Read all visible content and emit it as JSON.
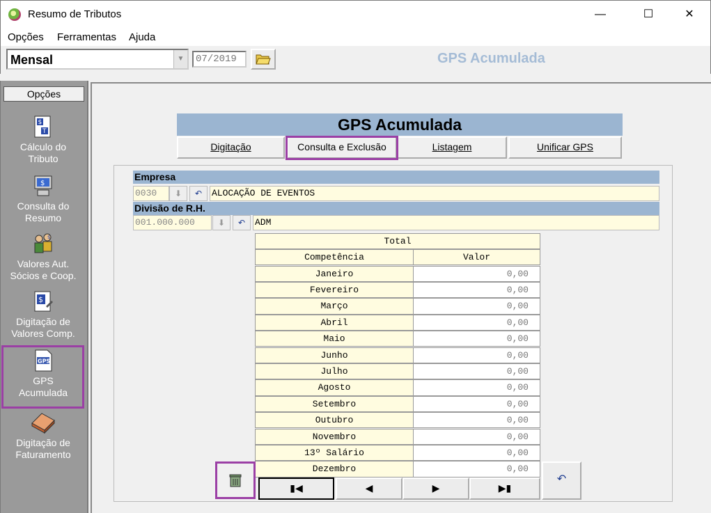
{
  "window": {
    "title": "Resumo de Tributos"
  },
  "menu": {
    "items": [
      "Opções",
      "Ferramentas",
      "Ajuda"
    ]
  },
  "toolbar": {
    "mode": "Mensal",
    "period": "07/2019",
    "header_title": "GPS Acumulada"
  },
  "sidebar": {
    "header": "Opções",
    "items": [
      {
        "label1": "Cálculo do",
        "label2": "Tributo"
      },
      {
        "label1": "Consulta do",
        "label2": "Resumo"
      },
      {
        "label1": "Valores Aut.",
        "label2": "Sócios e  Coop."
      },
      {
        "label1": "Digitação de",
        "label2": "Valores Comp."
      },
      {
        "label1": "GPS",
        "label2": "Acumulada"
      },
      {
        "label1": "Digitação de",
        "label2": "Faturamento"
      }
    ]
  },
  "main": {
    "title": "GPS Acumulada",
    "tabs": [
      "Digitação",
      "Consulta e Exclusão",
      "Listagem",
      "Unificar GPS"
    ],
    "empresa": {
      "label": "Empresa",
      "code": "0030",
      "name": "ALOCAÇÃO DE EVENTOS"
    },
    "divisao": {
      "label": "Divisão de R.H.",
      "code": "001.000.000",
      "name": "ADM"
    },
    "grid": {
      "total_label": "Total",
      "col_competencia": "Competência",
      "col_valor": "Valor",
      "rows": [
        {
          "month": "Janeiro",
          "value": "0,00"
        },
        {
          "month": "Fevereiro",
          "value": "0,00"
        },
        {
          "month": "Março",
          "value": "0,00"
        },
        {
          "month": "Abril",
          "value": "0,00"
        },
        {
          "month": "Maio",
          "value": "0,00"
        },
        {
          "month": "Junho",
          "value": "0,00"
        },
        {
          "month": "Julho",
          "value": "0,00"
        },
        {
          "month": "Agosto",
          "value": "0,00"
        },
        {
          "month": "Setembro",
          "value": "0,00"
        },
        {
          "month": "Outubro",
          "value": "0,00"
        },
        {
          "month": "Novembro",
          "value": "0,00"
        },
        {
          "month": "13º Salário",
          "value": "0,00"
        },
        {
          "month": "Dezembro",
          "value": "0,00"
        }
      ]
    }
  }
}
